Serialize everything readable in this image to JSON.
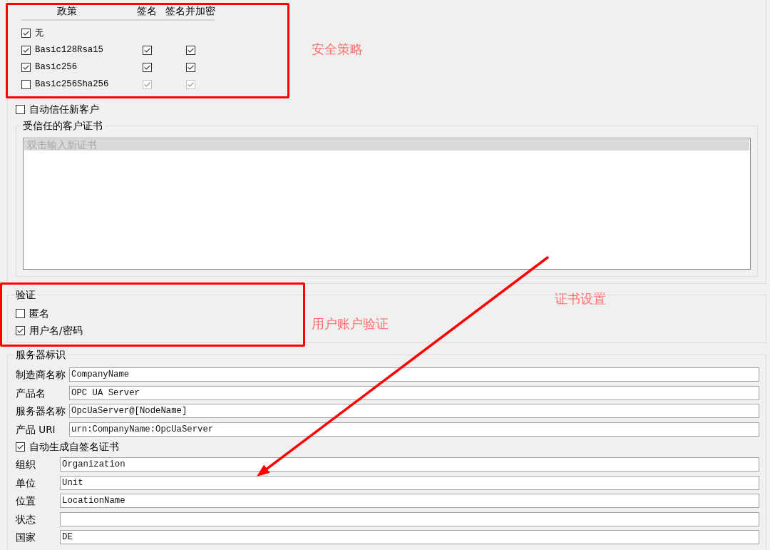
{
  "security_policies": {
    "columns": [
      "政策",
      "签名",
      "签名并加密"
    ],
    "rows": [
      {
        "name": "无",
        "checked": true
      },
      {
        "name": "Basic128Rsa15",
        "checked": true,
        "sign": {
          "checked": true,
          "disabled": false
        },
        "sign_encrypt": {
          "checked": true,
          "disabled": false
        }
      },
      {
        "name": "Basic256",
        "checked": true,
        "sign": {
          "checked": true,
          "disabled": false
        },
        "sign_encrypt": {
          "checked": true,
          "disabled": false
        }
      },
      {
        "name": "Basic256Sha256",
        "checked": false,
        "sign": {
          "checked": true,
          "disabled": true
        },
        "sign_encrypt": {
          "checked": true,
          "disabled": true
        }
      }
    ]
  },
  "auto_trust_new_clients": {
    "label": "自动信任新客户",
    "checked": false
  },
  "trusted_client_certificates": {
    "title": "受信任的客户证书",
    "items": [
      {
        "text": "双击输入新证书",
        "kind": "hint",
        "selected": true
      }
    ]
  },
  "authentication": {
    "title": "验证",
    "options": [
      {
        "label": "匿名",
        "checked": false
      },
      {
        "label": "用户名/密码",
        "checked": true
      }
    ]
  },
  "server_identity": {
    "title": "服务器标识",
    "fields": [
      {
        "label": "制造商名称",
        "value": "CompanyName"
      },
      {
        "label": "产品名",
        "value": "OPC UA Server"
      },
      {
        "label": "服务器名称",
        "value": "OpcUaServer@[NodeName]"
      },
      {
        "label": "产品 URI",
        "value": "urn:CompanyName:OpcUaServer"
      }
    ],
    "auto_self_signed_certificate": {
      "label": "自动生成自签名证书",
      "checked": true
    },
    "certificate_fields": [
      {
        "label": "组织",
        "value": "Organization"
      },
      {
        "label": "单位",
        "value": "Unit"
      },
      {
        "label": "位置",
        "value": "LocationName"
      },
      {
        "label": "状态"
      },
      {
        "label": "国家",
        "value": "DE"
      }
    ]
  },
  "annotations": [
    {
      "text": "安全策略"
    },
    {
      "text": "用户账户验证"
    },
    {
      "text": "证书设置"
    }
  ]
}
